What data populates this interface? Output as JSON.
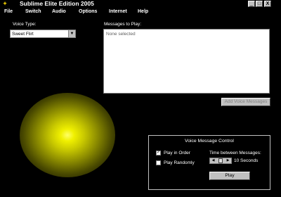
{
  "window": {
    "title": "Sublime Elite Edition 2005",
    "icon": "wrench-icon",
    "buttons": {
      "minimize": "_",
      "maximize": "□",
      "close": "X"
    }
  },
  "menu": [
    "File",
    "Switch",
    "Audio",
    "Options",
    "Internet",
    "Help"
  ],
  "voice_type": {
    "label": "Voice Type:",
    "selected": "Sweet Flirt"
  },
  "messages": {
    "label": "Messages to Play:",
    "content": "None selected",
    "add_button": "Add Voice Messages"
  },
  "voice_control": {
    "title": "Voice Message Control",
    "play_in_order": {
      "label": "Play in Order",
      "checked": true
    },
    "play_randomly": {
      "label": "Play Randomly",
      "checked": false
    },
    "time_label": "Time between Messages:",
    "time_value": "10 Seconds",
    "play_button": "Play"
  }
}
